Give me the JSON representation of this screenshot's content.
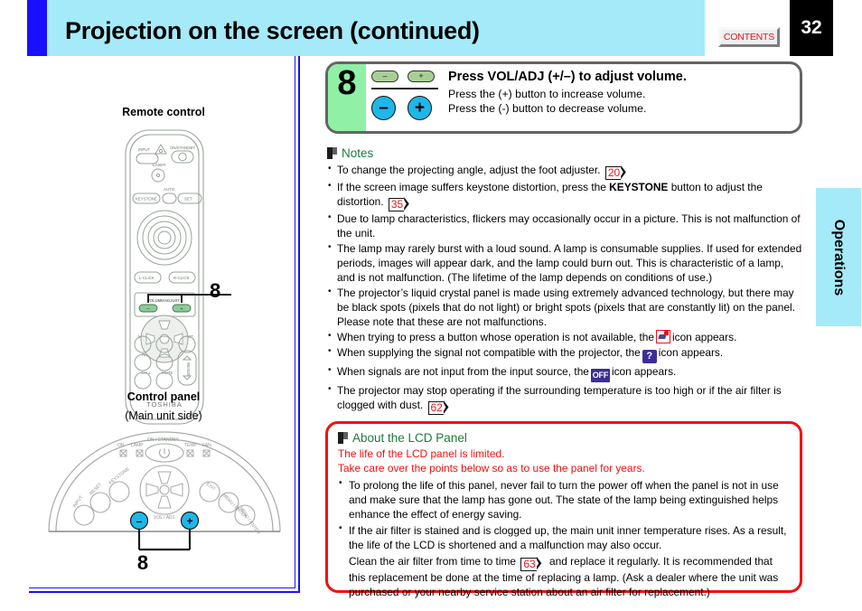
{
  "header": {
    "title": "Projection on the screen (continued)",
    "contents_label": "CONTENTS",
    "page_number": "32"
  },
  "side_tab": {
    "label": "Operations"
  },
  "left_column": {
    "remote": {
      "title": "Remote control",
      "callout_number": "8",
      "button_labels": {
        "input": "INPUT",
        "on_standby": "ON/STANDBY",
        "laser": "LASER",
        "keystone": "KEYSTONE",
        "auto": "AUTO",
        "set": "SET",
        "l_click": "L-CLICK",
        "r_click": "R-CLICK",
        "volume_adjust": "VOLUME/ADJUST",
        "menu": "MENU",
        "enter": "ENTER",
        "exit": "EXIT",
        "rs": "R/S",
        "freeze": "FREEZE",
        "call": "CALL",
        "mute": "MUTE",
        "resize": "RESIZE",
        "brand": "TOSHIBA",
        "minus": "–",
        "plus": "+"
      }
    },
    "control_panel": {
      "title": "Control panel",
      "subtitle": "(Main unit side)",
      "callout_number": "8",
      "button_labels": {
        "on_standby": "ON / STANDBY",
        "on": "ON",
        "lamp": "LAMP",
        "temp": "TEMP",
        "fan": "FAN",
        "keystone": "KEYSTONE",
        "reset": "RESET",
        "input": "INPUT",
        "exit": "EXIT",
        "menu_enter": "MENU / ENTER",
        "vol_adj": "VOL / ADJ",
        "minus": "–",
        "plus": "+"
      }
    }
  },
  "step": {
    "number": "8",
    "heading": "Press VOL/ADJ (+/–) to adjust volume.",
    "line1": "Press the (+) button to increase volume.",
    "line2": "Press the (-) button to decrease volume.",
    "icon_minus": "–",
    "icon_plus": "+"
  },
  "notes": {
    "heading": "Notes",
    "items": [
      {
        "text_before": "To change the projecting angle, adjust the foot adjuster.",
        "pageref": "20",
        "text_after": ""
      },
      {
        "text_before": "If the screen image suffers keystone distortion, press the",
        "keyword": "KEYSTONE",
        "text_mid": "button to adjust the distortion.",
        "pageref": "35",
        "text_after": ""
      },
      {
        "text_before": "Due to lamp characteristics, flickers may occasionally occur in a picture. This is not malfunction of the unit."
      },
      {
        "text_before": "The lamp may rarely burst with a loud sound. A lamp is consumable supplies. If used for extended periods, images will appear dark, and the lamp could burn out. This is characteristic of a lamp, and is not malfunction. (The lifetime of the lamp depends on conditions of use.)"
      },
      {
        "text_before": "The projector’s liquid crystal panel is made using extremely advanced technology, but there may be black spots (pixels that do not light) or bright spots (pixels that are constantly lit) on the panel. Please note that these are not malfunctions."
      },
      {
        "text_before": "When trying to press a button whose operation is not available, the",
        "icon": "no-operation-icon",
        "text_after": "icon appears."
      },
      {
        "text_before": "When supplying the signal not compatible with the projector, the",
        "icon": "question-mark-icon",
        "icon_text": "?",
        "text_after": "icon appears."
      },
      {
        "text_before": "When signals are not input from the input source, the",
        "icon": "off-icon",
        "icon_text": "OFF",
        "text_after": "icon appears."
      },
      {
        "text_before": "The projector may stop operating if the surrounding temperature is too high or if the air filter is clogged with dust.",
        "pageref": "62",
        "text_after": ""
      }
    ]
  },
  "lcd_panel": {
    "heading": "About the LCD Panel",
    "red_line1": "The life of the LCD panel is limited.",
    "red_line2": "Take care over the points below so as to use the panel for years.",
    "bullet1": "To prolong the life of this panel, never fail to turn the power off when the panel is not in use and make sure that the lamp has gone out. The state of the lamp being extinguished helps enhance the effect of energy saving.",
    "bullet2": "If the air filter is stained and is clogged up, the main unit inner temperature rises. As a result, the life of the LCD is shortened and a malfunction may also occur.",
    "continuation_before": "Clean the air filter from time to time",
    "continuation_pageref": "63",
    "continuation_after": "and replace it regularly. It is recommended that this replacement be done at the time of replacing a lamp. (Ask a dealer where the unit was purchased or your nearby service station about an air filter for replacement.)"
  },
  "colors": {
    "header_bg": "#a5eaf9",
    "header_accent": "#1810ff",
    "step_panel_green": "#90f0a5",
    "button_cyan": "#1fb6e8",
    "button_green": "#a8cf93",
    "heading_green": "#1d7a3e",
    "alert_red": "#f20f0f",
    "pageref_red": "#e8141e",
    "icon_blue": "#3b2f96"
  }
}
